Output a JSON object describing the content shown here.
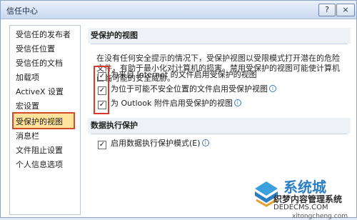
{
  "window": {
    "title": "信任中心",
    "help_label": "?",
    "close_label": "×"
  },
  "sidebar": {
    "items": [
      {
        "label": "受信任的发布者"
      },
      {
        "label": "受信任位置"
      },
      {
        "label": "受信任的文档"
      },
      {
        "label": "加载项"
      },
      {
        "label": "ActiveX 设置"
      },
      {
        "label": "宏设置"
      },
      {
        "label": "受保护的视图",
        "selected": true
      },
      {
        "label": "消息栏"
      },
      {
        "label": "文件阻止设置"
      },
      {
        "label": "个人信息选项"
      }
    ]
  },
  "protected_view": {
    "title": "受保护的视图",
    "description": "在没有任何安全提示的情况下，受保护视图以受限模式打开潜在的危险文件，有助于最小化对计算机的损害。禁用受保护的视图可能使计算机面临可能的安全威胁。",
    "options": [
      {
        "label": "为来自 Internet 的文件启用受保护的视图",
        "checked": true,
        "info": false
      },
      {
        "label": "为位于可能不安全位置的文件启用受保护视图",
        "checked": true,
        "info": true
      },
      {
        "label": "为 Outlook 附件启用受保护的视图",
        "checked": true,
        "info": true
      }
    ]
  },
  "dep": {
    "title": "数据执行保护",
    "option": {
      "label": "启用数据执行保护模式(E)",
      "checked": true,
      "info": true
    }
  },
  "watermark": {
    "line1": "系统城",
    "line2": "织梦内容管理系统",
    "line3": "DEDECMS.COM",
    "line4": "xitongcheng.com"
  },
  "info_glyph": "i",
  "check_glyph": "✓"
}
